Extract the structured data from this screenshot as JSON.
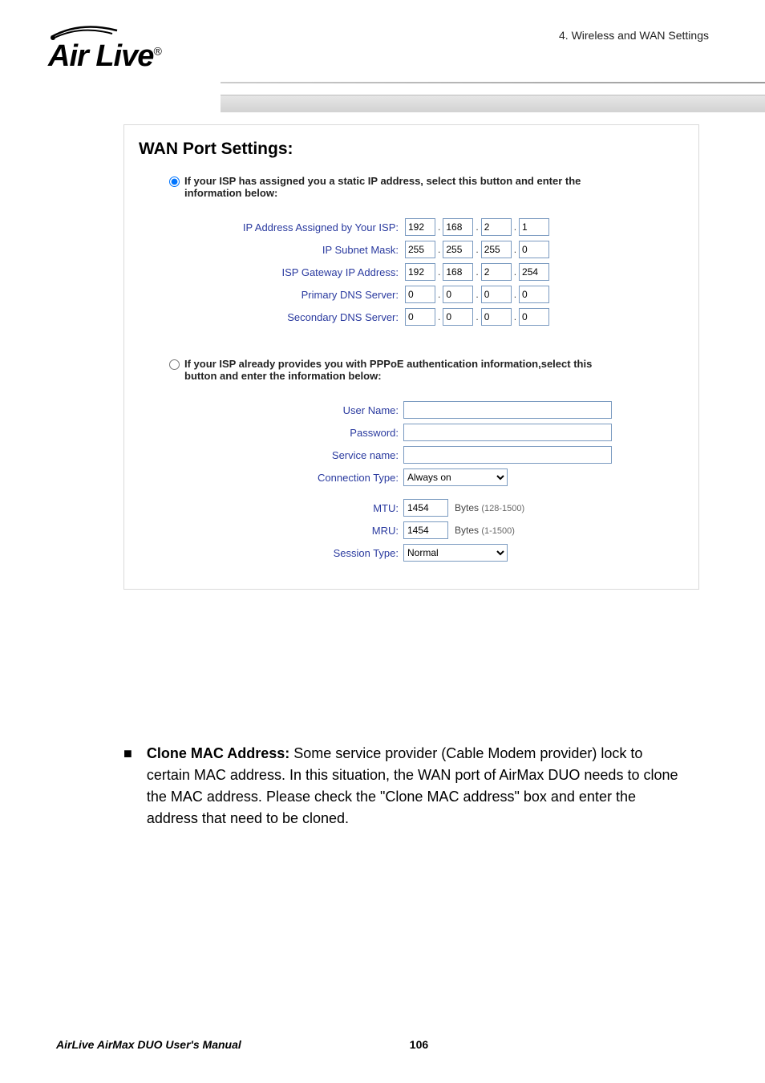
{
  "header": {
    "section": "4. Wireless and WAN Settings"
  },
  "logo": {
    "text": "Air Live",
    "reg": "®"
  },
  "panel": {
    "title": "WAN Port Settings:",
    "static_radio_label": "If your ISP has assigned you a static IP address, select this button and enter the information below:",
    "pppoe_radio_label": "If your ISP already provides you with PPPoE authentication information,select this button and enter the information below:",
    "labels": {
      "ip_assigned": "IP Address Assigned by Your ISP:",
      "subnet": "IP Subnet Mask:",
      "gateway": "ISP Gateway IP Address:",
      "primary_dns": "Primary DNS Server:",
      "secondary_dns": "Secondary DNS Server:",
      "username": "User Name:",
      "password": "Password:",
      "servicename": "Service name:",
      "conntype": "Connection Type:",
      "mtu": "MTU:",
      "mru": "MRU:",
      "sessiontype": "Session Type:"
    },
    "values": {
      "ip_assigned": [
        "192",
        "168",
        "2",
        "1"
      ],
      "subnet": [
        "255",
        "255",
        "255",
        "0"
      ],
      "gateway": [
        "192",
        "168",
        "2",
        "254"
      ],
      "primary_dns": [
        "0",
        "0",
        "0",
        "0"
      ],
      "secondary_dns": [
        "0",
        "0",
        "0",
        "0"
      ],
      "username": "",
      "password": "",
      "servicename": "",
      "conntype": "Always on",
      "mtu": "1454",
      "mru": "1454",
      "sessiontype": "Normal"
    },
    "hints": {
      "mtu": "Bytes ",
      "mtu_range": "(128-1500)",
      "mru": "Bytes ",
      "mru_range": "(1-1500)"
    }
  },
  "body": {
    "bullet": "■",
    "bold": "Clone MAC Address:",
    "text": " Some service provider (Cable Modem provider) lock to certain MAC address. In this situation, the WAN port of AirMax DUO needs to clone the MAC address. Please check the \"Clone MAC address\" box and enter the address that need to be cloned."
  },
  "footer": {
    "manual": "AirLive AirMax DUO User's Manual",
    "page": "106"
  }
}
